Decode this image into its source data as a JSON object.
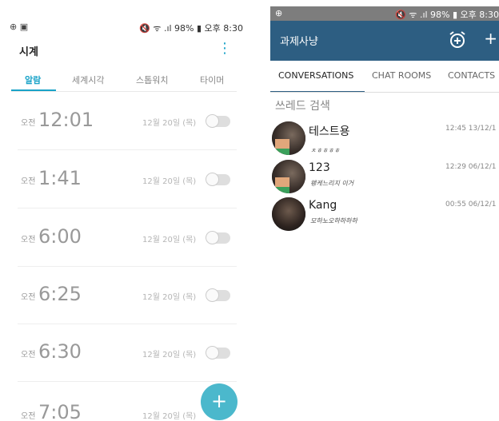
{
  "left_status": {
    "left_icons": "⊕ ▣",
    "right": "🔇 ᯤ .ıl 98% ▮ 오후 8:30"
  },
  "clock_app": {
    "title": "시계",
    "menu_icon": "more-vert-icon",
    "tabs": [
      {
        "label": "알람",
        "active": true
      },
      {
        "label": "세계시각",
        "active": false
      },
      {
        "label": "스톱워치",
        "active": false
      },
      {
        "label": "타이머",
        "active": false
      }
    ],
    "alarms": [
      {
        "ampm": "오전",
        "time": "12:01",
        "date": "12월 20일 (목)",
        "enabled": false
      },
      {
        "ampm": "오전",
        "time": "1:41",
        "date": "12월 20일 (목)",
        "enabled": false
      },
      {
        "ampm": "오전",
        "time": "6:00",
        "date": "12월 20일 (목)",
        "enabled": false
      },
      {
        "ampm": "오전",
        "time": "6:25",
        "date": "12월 20일 (목)",
        "enabled": false
      },
      {
        "ampm": "오전",
        "time": "6:30",
        "date": "12월 20일 (목)",
        "enabled": false
      },
      {
        "ampm": "오전",
        "time": "7:05",
        "date": "12월 20일 (목)",
        "enabled": false
      }
    ],
    "fab_label": "+"
  },
  "right_status": {
    "left_icons": "⊕",
    "right": "🔇 ᯤ .ıl 98% ▮ 오후 8:30"
  },
  "chat_app": {
    "title": "과제사냥",
    "accent": "#2d5e82",
    "plus_label": "+",
    "tabs": [
      {
        "label": "CONVERSATIONS",
        "active": true
      },
      {
        "label": "CHAT ROOMS",
        "active": false
      },
      {
        "label": "CONTACTS",
        "active": false
      }
    ],
    "search_placeholder": "쓰레드 검색",
    "conversations": [
      {
        "name": "테스트용",
        "message": "ㅊㅎㅎㅎㅎ",
        "time": "12:45 13/12/1"
      },
      {
        "name": "123",
        "message": "왱케느리지 이거",
        "time": "12:29 06/12/1"
      },
      {
        "name": "Kang",
        "message": "모하노오하하하하",
        "time": "00:55 06/12/1"
      }
    ]
  }
}
